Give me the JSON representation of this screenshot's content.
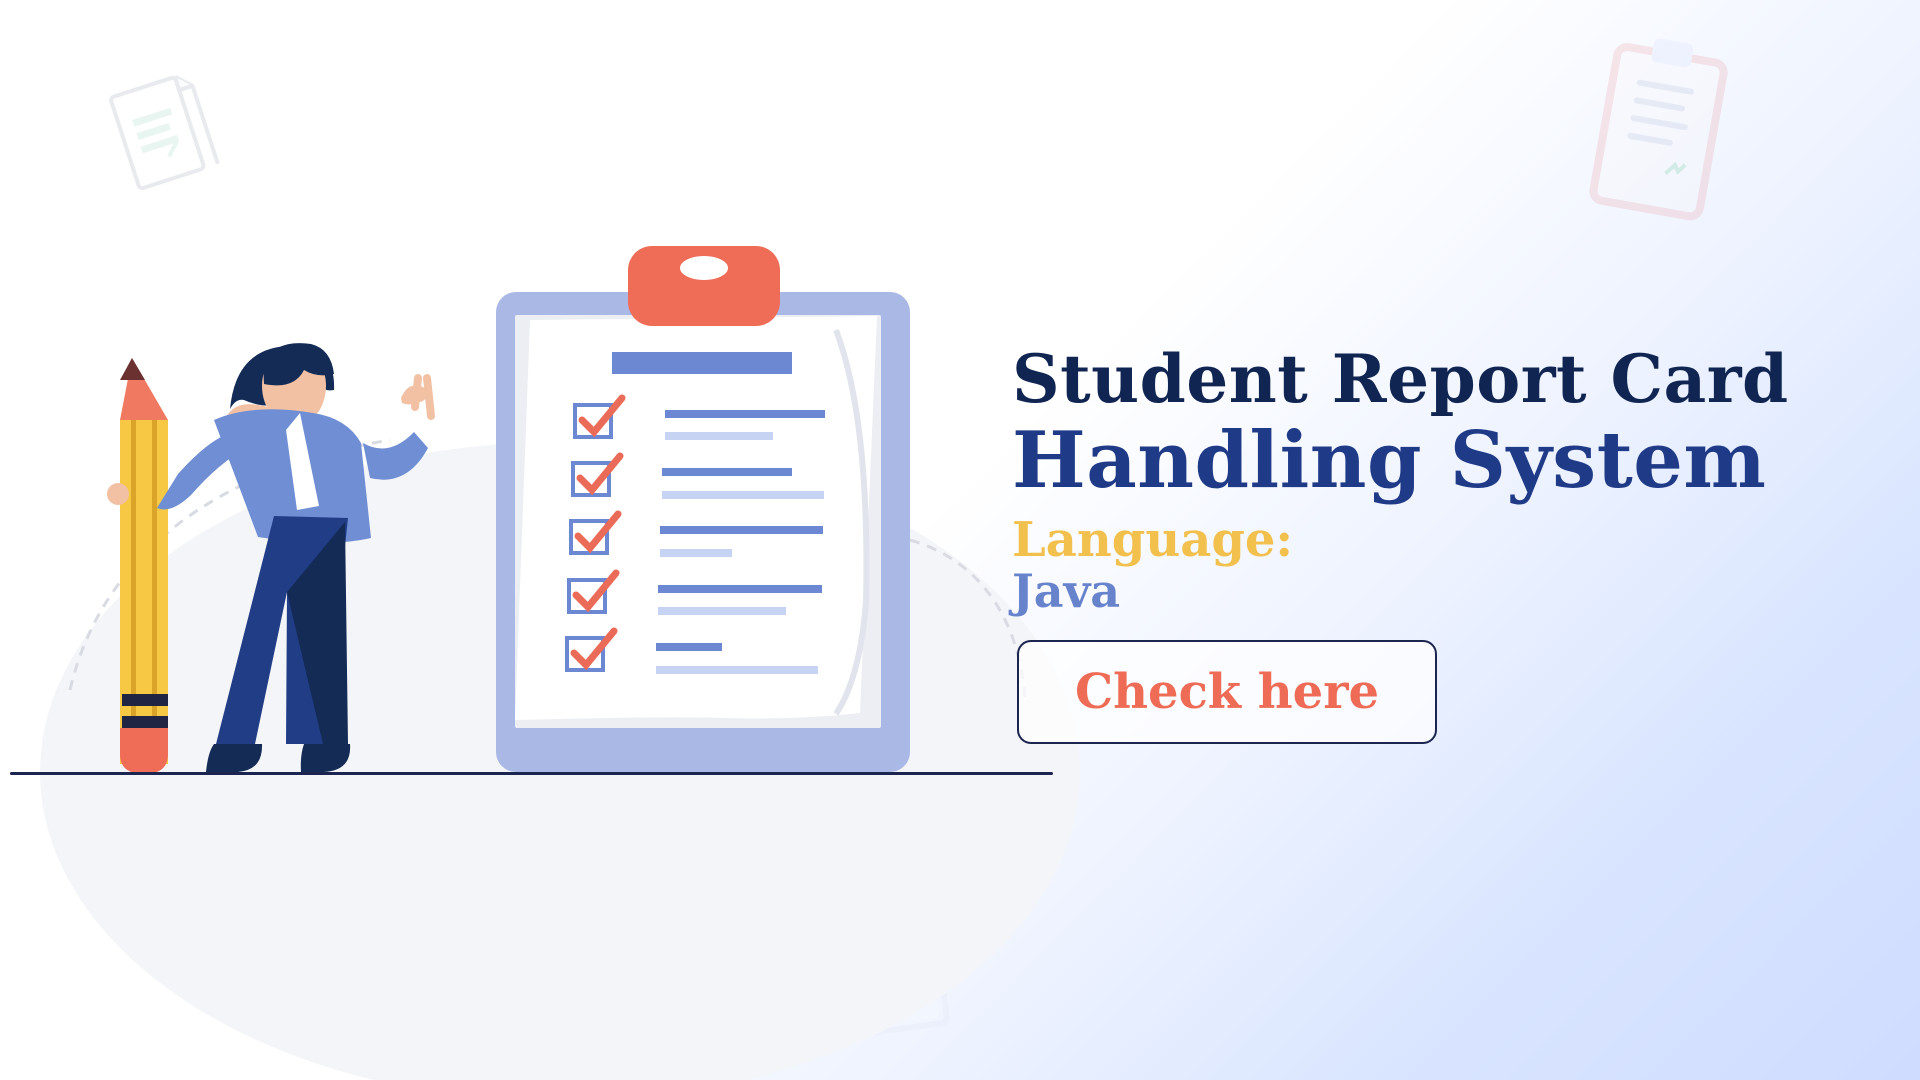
{
  "hero": {
    "title_line_1": "Student Report Card",
    "title_line_2": "Handling System",
    "language_label": "Language:",
    "language_value": "Java"
  },
  "actions": {
    "check_here_label": "Check here"
  },
  "icons": {
    "background_doc_left": "document-icon",
    "background_doc_top_right": "clipboard-icon",
    "background_doc_bottom": "grade-paper-icon",
    "pencil": "pencil-icon",
    "clipboard": "clipboard-checklist-icon",
    "person": "student-figure-icon"
  },
  "colors": {
    "title_dark": "#102552",
    "title_blue": "#1f3b88",
    "language_gold": "#f2c04d",
    "language_blue": "#6683cc",
    "button_text": "#ee6b55",
    "button_border": "#1b2550",
    "clipboard_blue": "#a6b7e4",
    "clip_orange": "#ef6c57"
  }
}
